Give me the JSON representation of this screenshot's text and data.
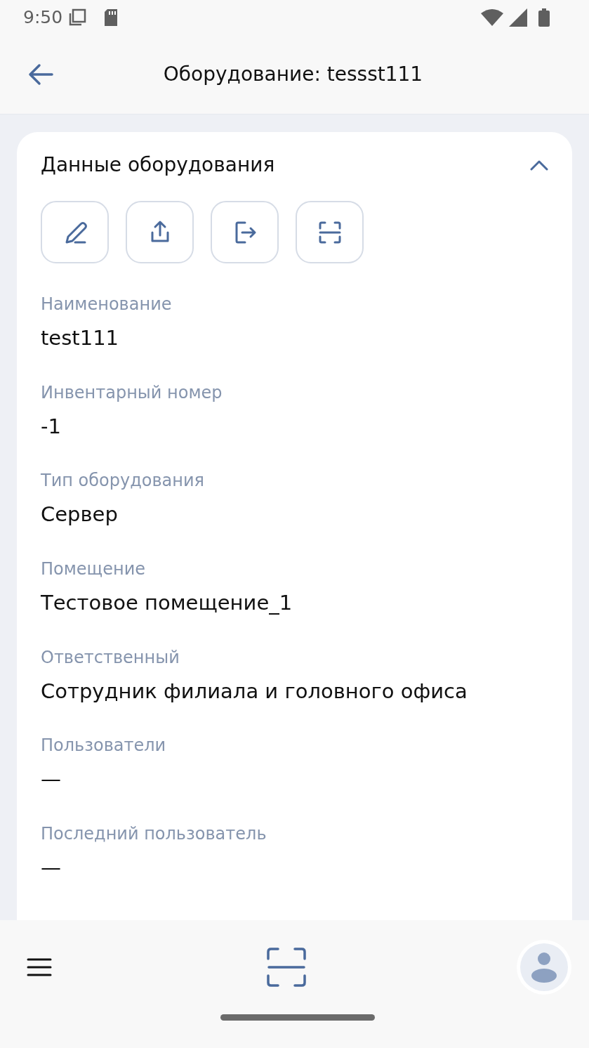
{
  "status_bar": {
    "time": "9:50"
  },
  "app_bar": {
    "title": "Оборудование: tessst111"
  },
  "card": {
    "title": "Данные оборудования",
    "expanded": true,
    "actions": [
      {
        "kind": "edit"
      },
      {
        "kind": "share"
      },
      {
        "kind": "exit"
      },
      {
        "kind": "scan"
      }
    ],
    "fields": [
      {
        "label": "Наименование",
        "value": "test111"
      },
      {
        "label": "Инвентарный номер",
        "value": "-1"
      },
      {
        "label": "Тип оборудования",
        "value": "Сервер"
      },
      {
        "label": "Помещение",
        "value": "Тестовое помещение_1"
      },
      {
        "label": "Ответственный",
        "value": "Сотрудник филиала и головного офиса"
      },
      {
        "label": "Пользователи",
        "value": "—"
      },
      {
        "label": "Последний пользователь",
        "value": "—"
      }
    ]
  }
}
